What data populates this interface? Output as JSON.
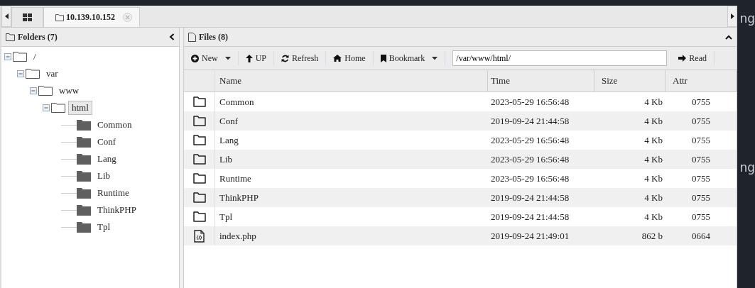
{
  "tabs": [
    {
      "kind": "grid",
      "selected": false
    },
    {
      "kind": "host",
      "label": "10.139.10.152",
      "selected": true
    }
  ],
  "folders": {
    "title": "Folders (7)",
    "tree": [
      {
        "name": "/",
        "expanded": true,
        "selected": false,
        "children": [
          {
            "name": "var",
            "expanded": true,
            "selected": false,
            "children": [
              {
                "name": "www",
                "expanded": true,
                "selected": false,
                "children": [
                  {
                    "name": "html",
                    "expanded": true,
                    "selected": true,
                    "children": [
                      {
                        "name": "Common",
                        "expanded": false,
                        "selected": false
                      },
                      {
                        "name": "Conf",
                        "expanded": false,
                        "selected": false
                      },
                      {
                        "name": "Lang",
                        "expanded": false,
                        "selected": false
                      },
                      {
                        "name": "Lib",
                        "expanded": false,
                        "selected": false
                      },
                      {
                        "name": "Runtime",
                        "expanded": false,
                        "selected": false
                      },
                      {
                        "name": "ThinkPHP",
                        "expanded": false,
                        "selected": false
                      },
                      {
                        "name": "Tpl",
                        "expanded": false,
                        "selected": false
                      }
                    ]
                  }
                ]
              }
            ]
          }
        ]
      }
    ]
  },
  "files": {
    "title": "Files (8)",
    "toolbar": [
      {
        "kind": "new",
        "label": "New",
        "dropdown": true
      },
      {
        "kind": "up",
        "label": "UP",
        "dropdown": false
      },
      {
        "kind": "refresh",
        "label": "Refresh",
        "dropdown": false
      },
      {
        "kind": "home",
        "label": "Home",
        "dropdown": false
      },
      {
        "kind": "bookmark",
        "label": "Bookmark",
        "dropdown": true
      }
    ],
    "path": "/var/www/html/",
    "read_button": "Read",
    "columns": [
      "Name",
      "Time",
      "Size",
      "Attr"
    ],
    "rows": [
      {
        "kind": "folder",
        "name": "Common",
        "time": "2023-05-29 16:56:48",
        "size": "4 Kb",
        "attr": "0755"
      },
      {
        "kind": "folder",
        "name": "Conf",
        "time": "2019-09-24 21:44:58",
        "size": "4 Kb",
        "attr": "0755"
      },
      {
        "kind": "folder",
        "name": "Lang",
        "time": "2023-05-29 16:56:48",
        "size": "4 Kb",
        "attr": "0755"
      },
      {
        "kind": "folder",
        "name": "Lib",
        "time": "2023-05-29 16:56:48",
        "size": "4 Kb",
        "attr": "0755"
      },
      {
        "kind": "folder",
        "name": "Runtime",
        "time": "2023-05-29 16:56:48",
        "size": "4 Kb",
        "attr": "0755"
      },
      {
        "kind": "folder",
        "name": "ThinkPHP",
        "time": "2019-09-24 21:44:58",
        "size": "4 Kb",
        "attr": "0755"
      },
      {
        "kind": "folder",
        "name": "Tpl",
        "time": "2019-09-24 21:44:58",
        "size": "4 Kb",
        "attr": "0755"
      },
      {
        "kind": "file",
        "name": "index.php",
        "time": "2019-09-24 21:49:01",
        "size": "862 b",
        "attr": "0664"
      }
    ]
  },
  "background_text": [
    "ng",
    "ng"
  ]
}
